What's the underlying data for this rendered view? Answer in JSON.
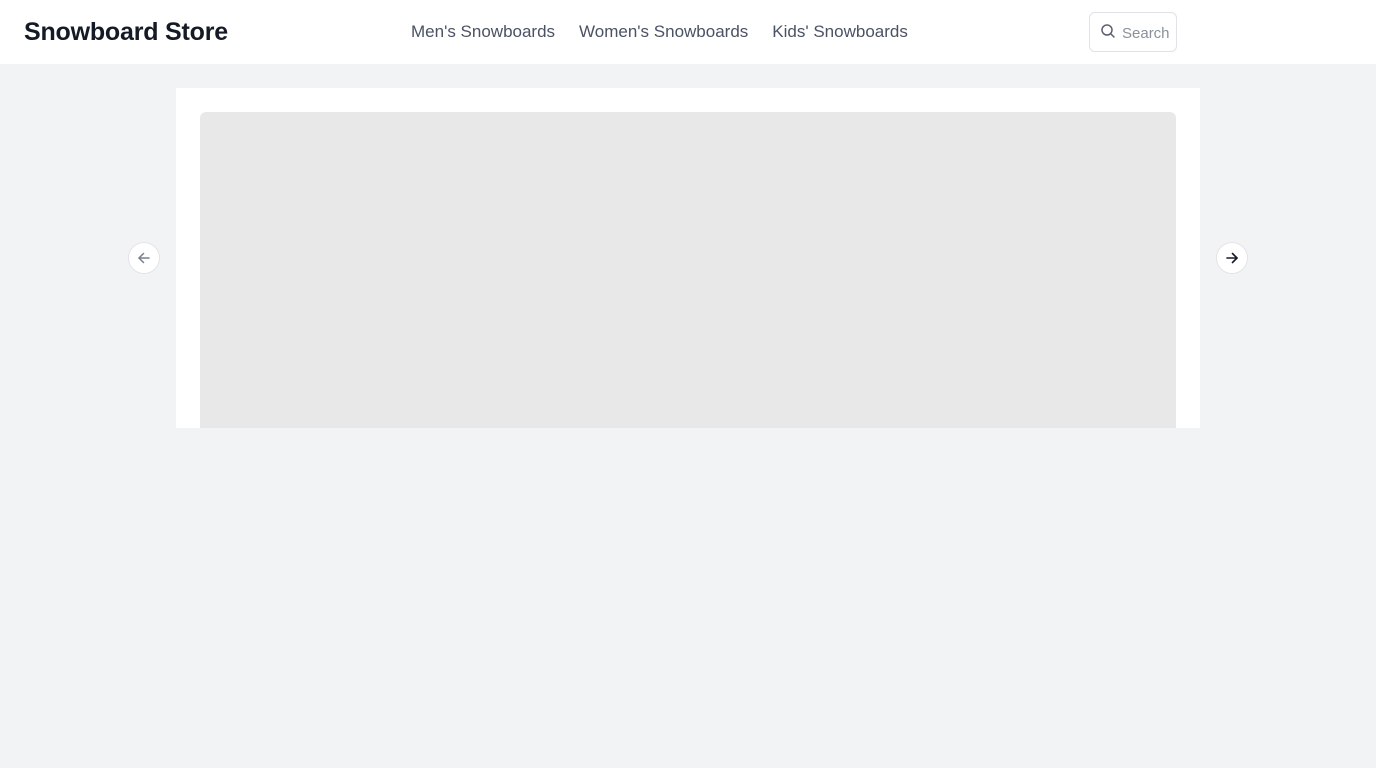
{
  "header": {
    "logo": "Snowboard Store",
    "nav": [
      {
        "label": "Men's Snowboards"
      },
      {
        "label": "Women's Snowboards"
      },
      {
        "label": "Kids' Snowboards"
      }
    ],
    "search": {
      "placeholder": "Search",
      "value": "",
      "icon": "search-icon"
    }
  },
  "carousel": {
    "prev_icon": "arrow-left-icon",
    "next_icon": "arrow-right-icon",
    "prev_enabled": false,
    "next_enabled": true
  },
  "colors": {
    "page_background": "#f2f3f5",
    "header_background": "#ffffff",
    "logo_text": "#141a26",
    "nav_text": "#4a5263",
    "image_placeholder": "#e8e8e8"
  }
}
